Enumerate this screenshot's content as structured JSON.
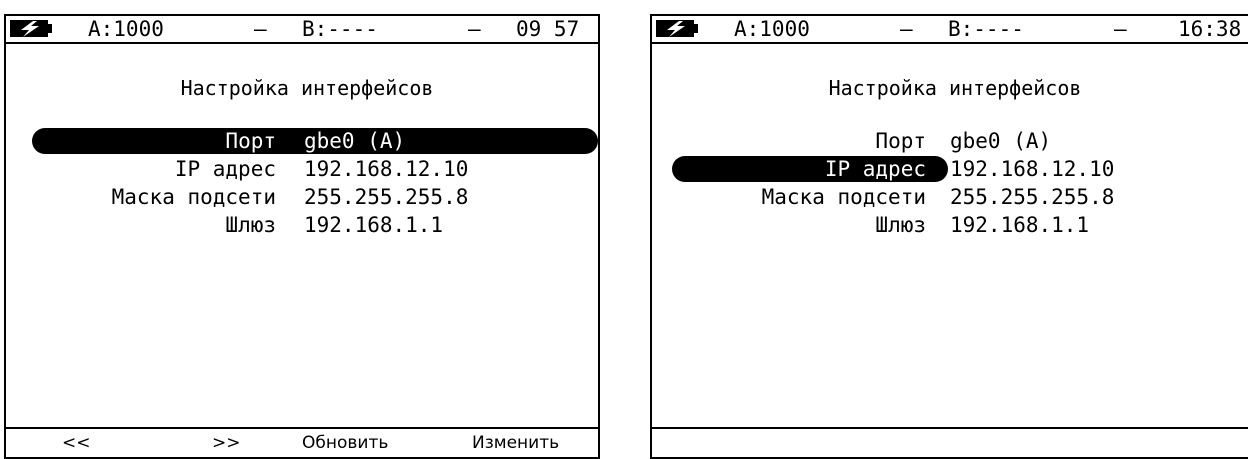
{
  "left_screen": {
    "status": {
      "battery_icon": "battery-charging-icon",
      "port_a": "A:1000",
      "sep1": "–",
      "port_b": "B:----",
      "sep2": "–",
      "time": "09 57"
    },
    "title": "Настройка интерфейсов",
    "rows": [
      {
        "label": "Порт",
        "value": "gbe0 (A)"
      },
      {
        "label": "IP адрес",
        "value": "192.168.12.10"
      },
      {
        "label": "Маска подсети",
        "value": "255.255.255.8"
      },
      {
        "label": "Шлюз",
        "value": "192.168.1.1"
      }
    ],
    "selected_row": "Порт",
    "softkeys": [
      "<<",
      ">>",
      "Обновить",
      "Изменить"
    ]
  },
  "right_screen": {
    "status": {
      "battery_icon": "battery-charging-icon",
      "port_a": "A:1000",
      "sep1": "–",
      "port_b": "B:----",
      "sep2": "–",
      "time": "16:38"
    },
    "title": "Настройка интерфейсов",
    "rows": [
      {
        "label": "Порт",
        "value": "gbe0 (A)"
      },
      {
        "label": "IP адрес",
        "value": "192.168.12.10"
      },
      {
        "label": "Маска подсети",
        "value": "255.255.255.8"
      },
      {
        "label": "Шлюз",
        "value": "192.168.1.1"
      }
    ],
    "selected_row": "IP адрес"
  }
}
